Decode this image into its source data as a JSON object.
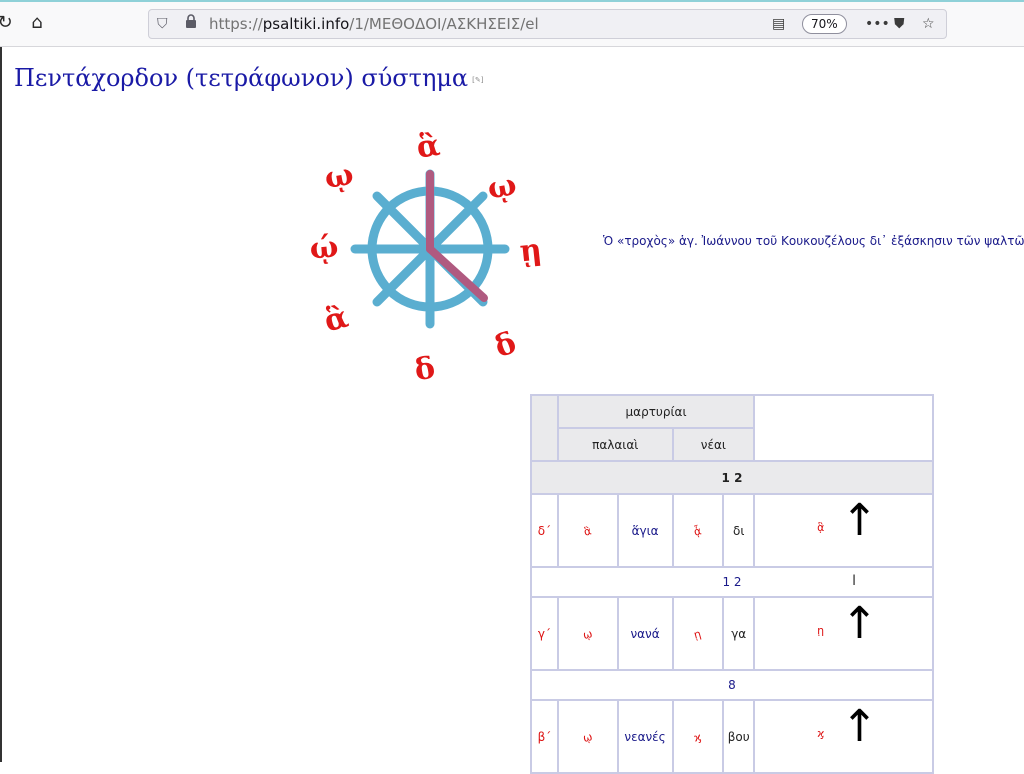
{
  "browser": {
    "url_prefix": "https://",
    "url_host": "psaltiki.info",
    "url_path": "/1/ΜΕΘΟΔΟΙ/ΑΣΚΗΣΕΙΣ/el",
    "zoom": "70%",
    "icons": {
      "reload": "reload-icon",
      "home": "home-icon",
      "shield": "tracking-shield-icon",
      "lock": "lock-icon",
      "reader": "reader-view-icon",
      "more": "more-actions-icon",
      "pocket": "pocket-icon",
      "bookmark": "bookmark-star-icon"
    }
  },
  "page": {
    "title": "Πεντάχορδον (τετράφωνον) σύστημα",
    "edit_link": "[✎]",
    "caption": "Ὁ «τροχὸς» ἁγ. Ἰωάννου τοῦ Κουκουζέλους δι᾿ ἐξάσκησιν τῶν ψαλτῶν κατὰ",
    "colors": {
      "wheel": "#5aaed0",
      "hands": "#b05a80",
      "neume": "#e01818",
      "title": "#1a1aa6"
    }
  },
  "table": {
    "header_group": "μαρτυρίαι",
    "header_old": "παλαιαὶ",
    "header_new": "νέαι",
    "first_interval": "1 2",
    "rows": [
      {
        "degree": "δ΄",
        "name": "ἅγια",
        "syllable": "δι"
      },
      {
        "degree": "γ΄",
        "name": "νανά",
        "syllable": "γα"
      },
      {
        "degree": "β΄",
        "name": "νεανές",
        "syllable": "βου"
      }
    ],
    "intervals": [
      "1 2",
      "8"
    ],
    "arrow": "↑"
  }
}
